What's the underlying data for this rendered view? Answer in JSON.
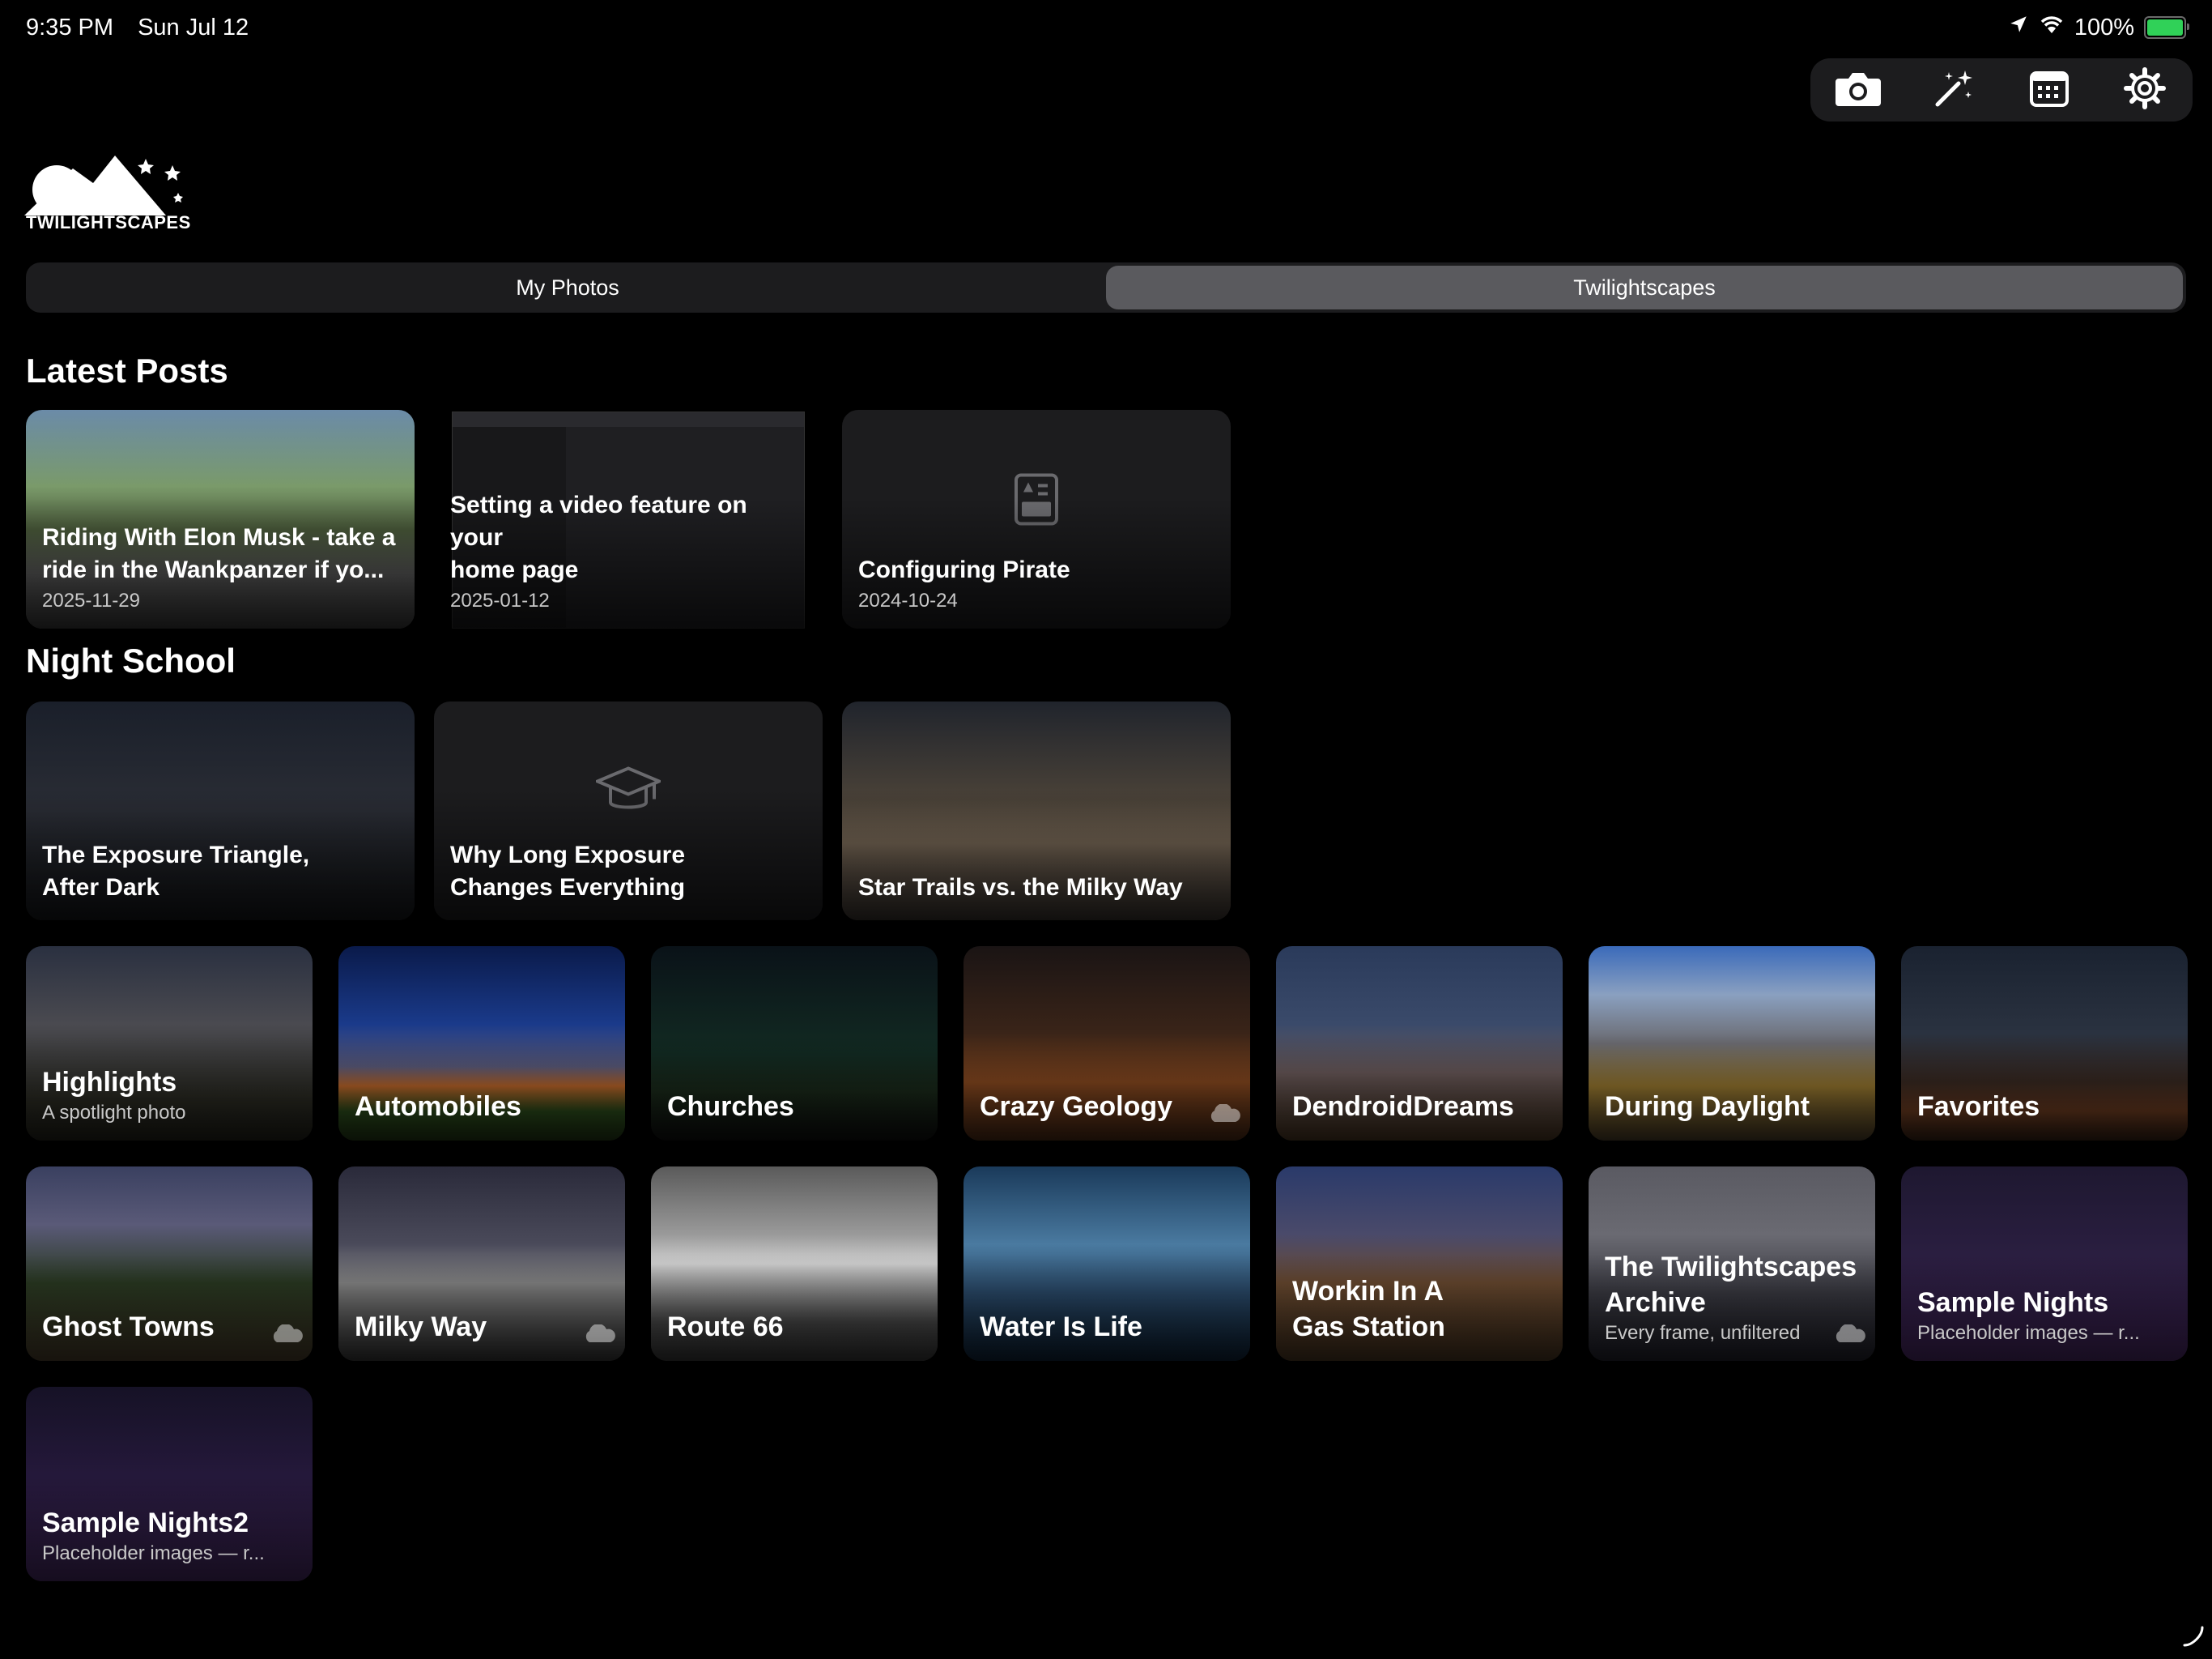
{
  "status_bar": {
    "time": "9:35 PM",
    "date": "Sun Jul 12",
    "battery": "100%"
  },
  "toolbar": {
    "icons": [
      "camera-icon",
      "magic-wand-icon",
      "calendar-icon",
      "gear-icon"
    ]
  },
  "logo": {
    "text": "TWILIGHTSCAPES"
  },
  "segments": {
    "my_photos": "My Photos",
    "twilightscapes": "Twilightscapes",
    "selected": "Twilightscapes"
  },
  "latest_posts": {
    "title": "Latest Posts",
    "items": [
      {
        "title": "Riding With Elon Musk - take a\nride in the Wankpanzer if yo...",
        "date": "2025-11-29"
      },
      {
        "title": "Setting a video feature on your\nhome page",
        "date": "2025-01-12"
      },
      {
        "title": "Configuring Pirate",
        "date": "2024-10-24"
      }
    ]
  },
  "night_school": {
    "title": "Night School",
    "items": [
      {
        "title": "The Exposure Triangle,\nAfter Dark"
      },
      {
        "title": "Why Long Exposure\nChanges Everything"
      },
      {
        "title": "Star Trails vs. the Milky Way"
      }
    ]
  },
  "albums": [
    {
      "title": "Highlights",
      "subtitle": "A spotlight photo"
    },
    {
      "title": "Automobiles",
      "subtitle": ""
    },
    {
      "title": "Churches",
      "subtitle": ""
    },
    {
      "title": "Crazy Geology",
      "subtitle": ""
    },
    {
      "title": "DendroidDreams",
      "subtitle": ""
    },
    {
      "title": "During Daylight",
      "subtitle": ""
    },
    {
      "title": "Favorites",
      "subtitle": ""
    },
    {
      "title": "Ghost Towns",
      "subtitle": ""
    },
    {
      "title": "Milky Way",
      "subtitle": ""
    },
    {
      "title": "Route 66",
      "subtitle": ""
    },
    {
      "title": "Water Is Life",
      "subtitle": ""
    },
    {
      "title": "Workin In A\nGas Station",
      "subtitle": ""
    },
    {
      "title": "The Twilightscapes\nArchive",
      "subtitle": "Every frame, unfiltered"
    },
    {
      "title": "Sample Nights",
      "subtitle": "Placeholder images — r..."
    },
    {
      "title": "Sample Nights2",
      "subtitle": "Placeholder images — r..."
    }
  ],
  "colors": {
    "background": "#000000",
    "card": "#1c1c1e",
    "segment_selected": "#5a5a5e",
    "battery": "#30d158"
  }
}
